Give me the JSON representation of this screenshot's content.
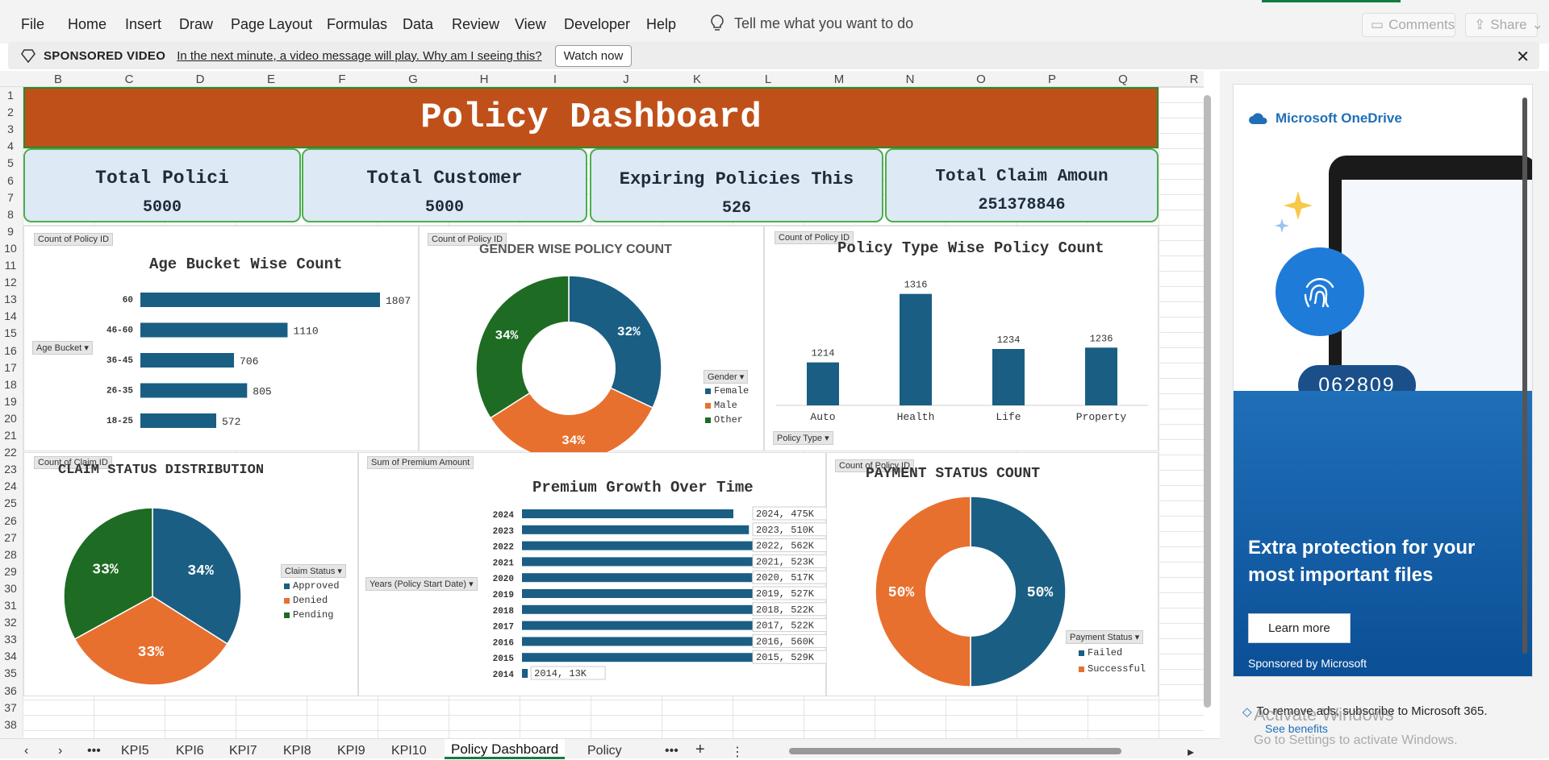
{
  "menu": [
    "File",
    "Home",
    "Insert",
    "Draw",
    "Page Layout",
    "Formulas",
    "Data",
    "Review",
    "View",
    "Developer",
    "Help"
  ],
  "tell_me": "Tell me what you want to do",
  "top_buttons": {
    "comments": "Comments",
    "share": "Share"
  },
  "adbar": {
    "label": "SPONSORED VIDEO",
    "link": "In the next minute, a video message will play. Why am I seeing this?",
    "button": "Watch now"
  },
  "columns": [
    "B",
    "C",
    "D",
    "E",
    "F",
    "G",
    "H",
    "I",
    "J",
    "K",
    "L",
    "M",
    "N",
    "O",
    "P",
    "Q",
    "R"
  ],
  "rows": [
    "1",
    "2",
    "3",
    "4",
    "5",
    "6",
    "7",
    "8",
    "9",
    "10",
    "11",
    "12",
    "13",
    "14",
    "15",
    "16",
    "17",
    "18",
    "19",
    "20",
    "21",
    "22",
    "23",
    "24",
    "25",
    "26",
    "27",
    "28",
    "29",
    "30",
    "31",
    "32",
    "33",
    "34",
    "35",
    "36",
    "37",
    "38"
  ],
  "dashboard": {
    "title": "Policy Dashboard",
    "kpis": [
      {
        "title": "Total Polici",
        "value": "5000"
      },
      {
        "title": "Total Customer",
        "value": "5000"
      },
      {
        "title": "Expiring Policies This",
        "value": "526"
      },
      {
        "title": "Total Claim Amoun",
        "value": "251378846"
      }
    ]
  },
  "charts": {
    "age": {
      "pivot": "Count of Policy ID",
      "dropdown": "Age Bucket",
      "title": "Age Bucket Wise Count"
    },
    "gender": {
      "pivot": "Count of Policy ID",
      "dropdown": "Gender",
      "title": "GENDER WISE POLICY COUNT"
    },
    "policytype": {
      "pivot": "Count of Policy ID",
      "dropdown": "Policy Type",
      "title": "Policy Type Wise Policy Count"
    },
    "claim": {
      "pivot": "Count of Claim ID",
      "dropdown": "Claim Status",
      "title": "CLAIM STATUS DISTRIBUTION"
    },
    "premium": {
      "pivot": "Sum of Premium Amount",
      "dropdown": "Years (Policy Start Date)",
      "title": "Premium Growth Over Time"
    },
    "payment": {
      "pivot": "Count of Policy ID",
      "dropdown": "Payment Status",
      "title": "PAYMENT STATUS COUNT"
    }
  },
  "chart_data": [
    {
      "id": "age",
      "type": "bar",
      "orientation": "horizontal",
      "title": "Age Bucket Wise Count",
      "categories": [
        "60",
        "46-60",
        "36-45",
        "26-35",
        "18-25"
      ],
      "values": [
        1807,
        1110,
        706,
        805,
        572
      ]
    },
    {
      "id": "gender",
      "type": "pie",
      "donut": true,
      "title": "GENDER WISE POLICY COUNT",
      "categories": [
        "Female",
        "Male",
        "Other"
      ],
      "values": [
        32,
        34,
        34
      ],
      "labels": [
        "32%",
        "34%",
        "34%"
      ]
    },
    {
      "id": "policytype",
      "type": "bar",
      "title": "Policy Type Wise Policy Count",
      "categories": [
        "Auto",
        "Health",
        "Life",
        "Property"
      ],
      "values": [
        1214,
        1316,
        1234,
        1236
      ],
      "ylim": [
        1150,
        1330
      ]
    },
    {
      "id": "claim",
      "type": "pie",
      "title": "CLAIM STATUS DISTRIBUTION",
      "categories": [
        "Approved",
        "Denied",
        "Pending"
      ],
      "values": [
        34,
        33,
        33
      ],
      "labels": [
        "34%",
        "33%",
        "33%"
      ]
    },
    {
      "id": "premium",
      "type": "bar",
      "orientation": "horizontal",
      "title": "Premium Growth Over Time",
      "categories": [
        "2024",
        "2023",
        "2022",
        "2021",
        "2020",
        "2019",
        "2018",
        "2017",
        "2016",
        "2015",
        "2014"
      ],
      "labels": [
        "2024, 475K",
        "2023, 510K",
        "2022, 562K",
        "2021, 523K",
        "2020, 517K",
        "2019, 527K",
        "2018, 522K",
        "2017, 522K",
        "2016, 560K",
        "2015, 529K",
        "2014, 13K"
      ],
      "values": [
        475,
        510,
        562,
        523,
        517,
        527,
        522,
        522,
        560,
        529,
        13
      ]
    },
    {
      "id": "payment",
      "type": "pie",
      "donut": true,
      "title": "PAYMENT STATUS COUNT",
      "categories": [
        "Failed",
        "Successful"
      ],
      "values": [
        50,
        50
      ],
      "labels": [
        "50%",
        "50%"
      ]
    }
  ],
  "colors": {
    "blue": "#1a5e84",
    "orange": "#e8702f",
    "green": "#1e6b23",
    "title_bg": "#c0501a",
    "kpi_bg": "#dde9f5"
  },
  "tabs": [
    "KPI5",
    "KPI6",
    "KPI7",
    "KPI8",
    "KPI9",
    "KPI10",
    "Policy Dashboard",
    "Policy"
  ],
  "ad": {
    "brand": "Microsoft OneDrive",
    "code": "062809",
    "headline": "Extra protection for your most important files",
    "button": "Learn more",
    "sponsor": "Sponsored by Microsoft",
    "remove": "To remove ads, subscribe to Microsoft 365.",
    "see": "See benefits",
    "activate": "Activate Windows",
    "activate_sub": "Go to Settings to activate Windows."
  }
}
